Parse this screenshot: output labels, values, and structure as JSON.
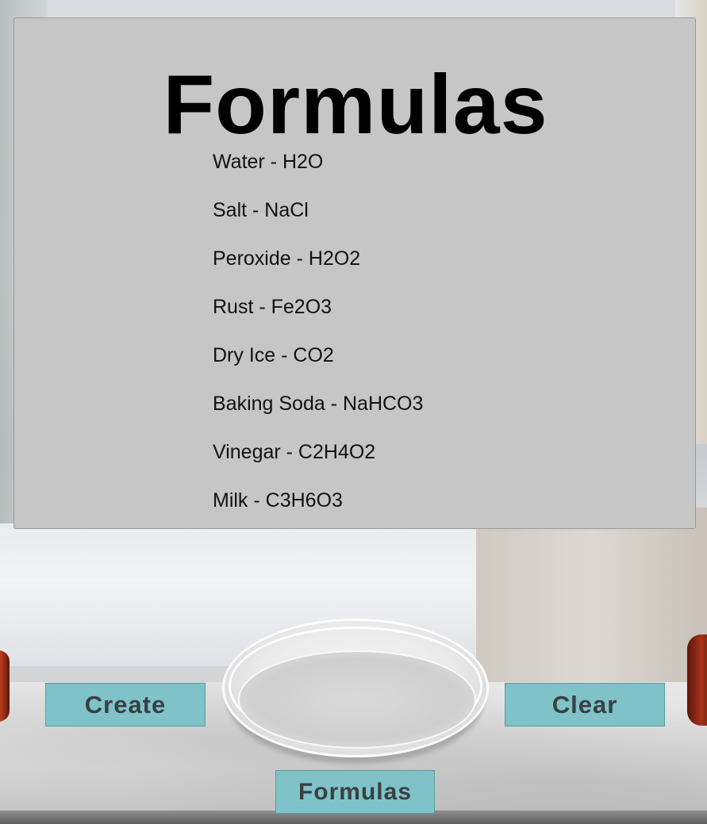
{
  "panel": {
    "title": "Formulas",
    "formulas": [
      "Water - H2O",
      "Salt - NaCl",
      "Peroxide - H2O2",
      "Rust - Fe2O3",
      "Dry Ice - CO2",
      "Baking Soda - NaHCO3",
      "Vinegar - C2H4O2",
      "Milk - C3H6O3"
    ]
  },
  "buttons": {
    "create_label": "Create",
    "clear_label": "Clear",
    "formulas_label": "Formulas"
  },
  "colors": {
    "panel_background": "#c6c6c6",
    "button_background": "#7fc3c9",
    "button_text": "#3a3f41"
  }
}
